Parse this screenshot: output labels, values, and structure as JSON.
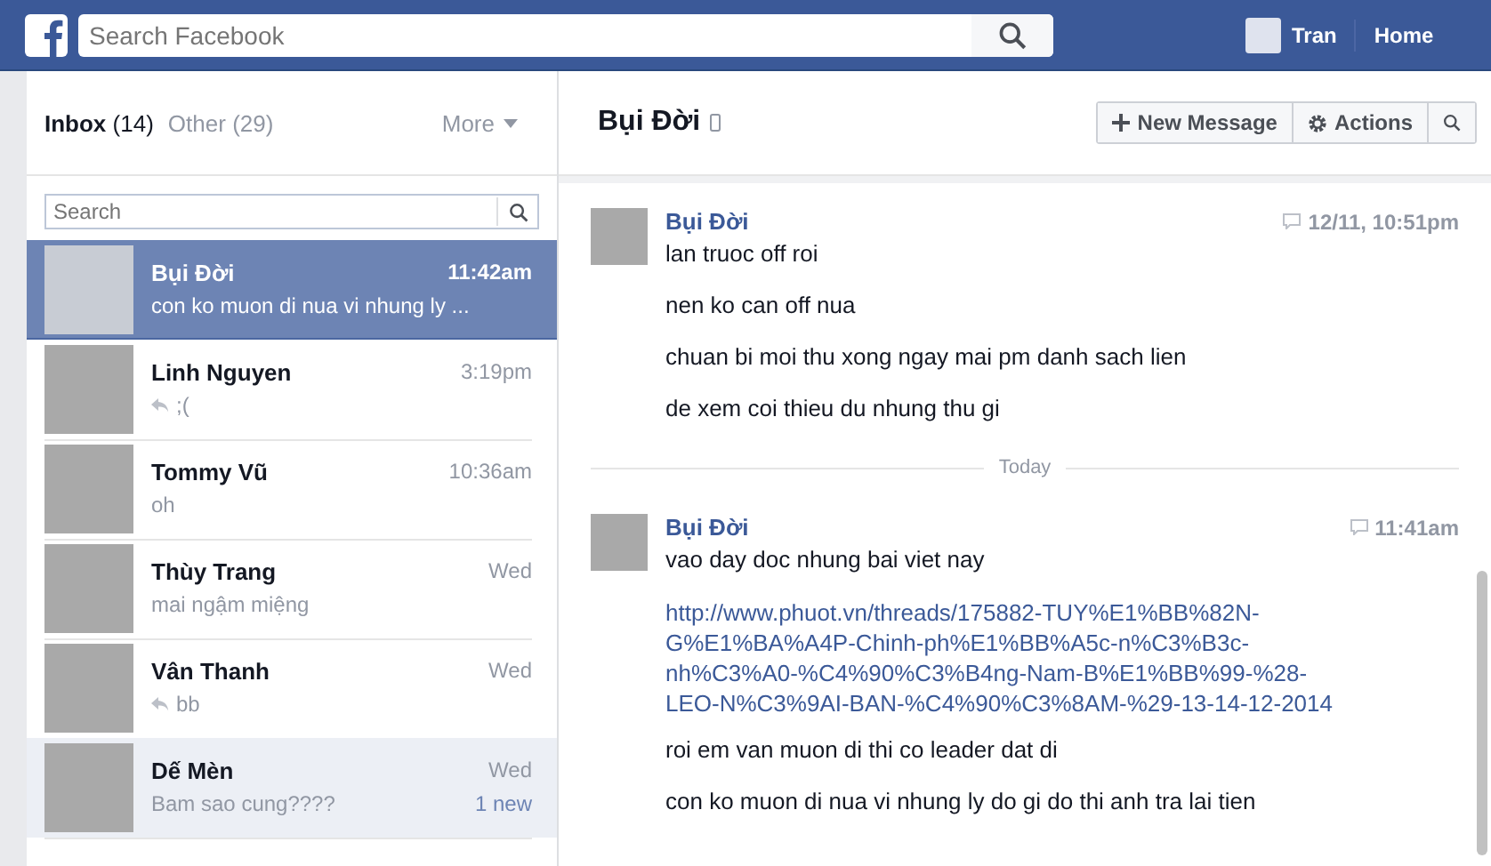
{
  "topbar": {
    "search_placeholder": "Search Facebook",
    "user": "Tran",
    "home": "Home"
  },
  "folders": [
    {
      "label": "Inbox",
      "count": "(14)",
      "selected": true
    },
    {
      "label": "Other",
      "count": "(29)",
      "selected": false
    }
  ],
  "more": "More",
  "list_search": {
    "placeholder": "Search"
  },
  "conversations": [
    {
      "name": "Bụi Đời",
      "time": "11:42am",
      "preview": "con ko muon di nua vi nhung ly ...",
      "replied": false,
      "selected": true,
      "unread": false
    },
    {
      "name": "Linh Nguyen",
      "time": "3:19pm",
      "preview": ";(",
      "replied": true,
      "selected": false,
      "unread": false
    },
    {
      "name": "Tommy Vũ",
      "time": "10:36am",
      "preview": "oh",
      "replied": false,
      "selected": false,
      "unread": false
    },
    {
      "name": "Thùy Trang",
      "time": "Wed",
      "preview": "mai ngậm miệng",
      "replied": false,
      "selected": false,
      "unread": false
    },
    {
      "name": "Vân Thanh",
      "time": "Wed",
      "preview": "bb",
      "replied": true,
      "selected": false,
      "unread": false
    },
    {
      "name": "Dế Mèn",
      "time": "Wed",
      "preview": "Bam sao cung????",
      "badge": "1 new",
      "replied": false,
      "selected": false,
      "unread": true
    }
  ],
  "thread_header": {
    "title": "Bụi Đời",
    "actions": [
      {
        "kind": "new",
        "label": "New Message"
      },
      {
        "kind": "actions",
        "label": "Actions"
      },
      {
        "kind": "search"
      }
    ]
  },
  "thread": [
    {
      "kind": "group",
      "sender": "Bụi Đời",
      "time": "12/11, 10:51pm",
      "messages": [
        {
          "kind": "text",
          "text": "lan truoc off roi"
        },
        {
          "kind": "text",
          "text": "nen ko can off nua"
        },
        {
          "kind": "text",
          "text": "chuan bi moi thu xong ngay mai pm danh sach lien"
        },
        {
          "kind": "text",
          "text": "de xem coi thieu du nhung thu gi"
        }
      ]
    },
    {
      "kind": "divider",
      "label": "Today"
    },
    {
      "kind": "group",
      "sender": "Bụi Đời",
      "time": "11:41am",
      "messages": [
        {
          "kind": "text",
          "text": "vao day doc nhung bai viet nay"
        },
        {
          "kind": "link",
          "text": "http://www.phuot.vn/threads/175882-TUY%E1%BB%82N-G%E1%BA%A4P-Chinh-ph%E1%BB%A5c-n%C3%B3c-nh%C3%A0-%C4%90%C3%B4ng-Nam-B%E1%BB%99-%28-LEO-N%C3%9AI-BAN-%C4%90%C3%8AM-%29-13-14-12-2014"
        },
        {
          "kind": "text",
          "text": "roi em van muon di thi co leader dat di"
        },
        {
          "kind": "text",
          "text": "con ko muon di nua vi nhung ly do gi do thi anh tra lai tien"
        }
      ]
    }
  ]
}
